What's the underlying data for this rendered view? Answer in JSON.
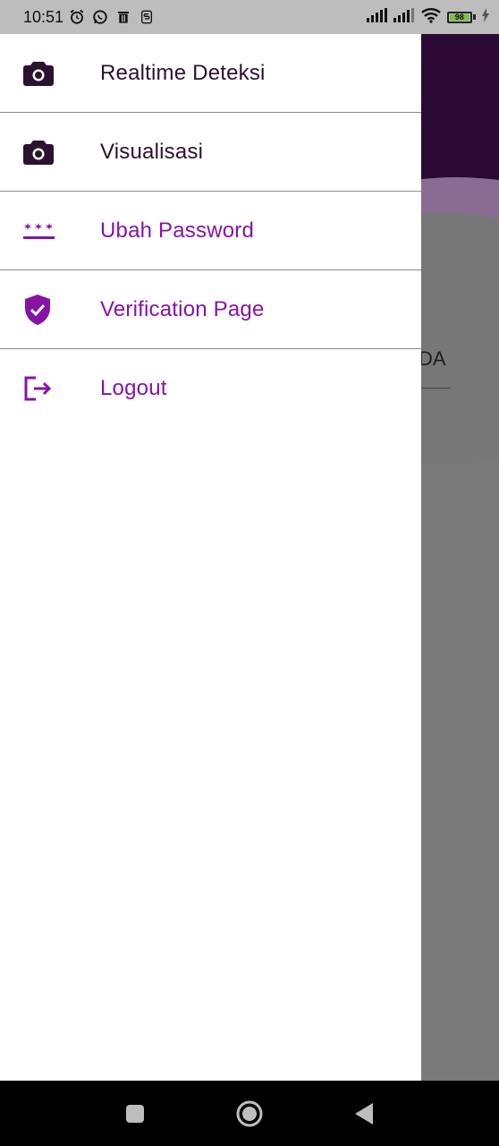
{
  "status_bar": {
    "time": "10:51",
    "battery_level": "98",
    "icons": [
      "alarm-icon",
      "whatsapp-icon",
      "trash-icon",
      "app-s-icon",
      "signal-icon",
      "signal-icon",
      "wifi-icon",
      "battery-icon",
      "charging-icon"
    ]
  },
  "background": {
    "partial_text": "DA"
  },
  "drawer": {
    "items": [
      {
        "label": "Realtime Deteksi",
        "icon": "camera-icon",
        "color": "#2b1230"
      },
      {
        "label": "Visualisasi",
        "icon": "camera-icon",
        "color": "#2b1230"
      },
      {
        "label": "Ubah Password",
        "icon": "password-icon",
        "color": "#8514a5"
      },
      {
        "label": "Verification Page",
        "icon": "verified-shield-icon",
        "color": "#8514a5"
      },
      {
        "label": "Logout",
        "icon": "logout-icon",
        "color": "#8514a5"
      }
    ]
  },
  "nav_bar": {
    "buttons": [
      "recents-button",
      "home-button",
      "back-button"
    ]
  },
  "colors": {
    "accent_purple": "#8514a5",
    "dark_text": "#2b1230",
    "header_purple": "#2a0a35",
    "scrim": "#777777"
  }
}
